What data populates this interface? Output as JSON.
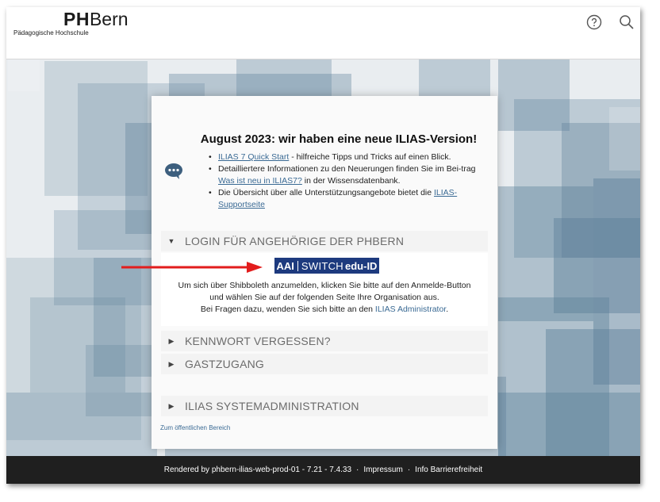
{
  "header": {
    "logo_bold": "PH",
    "logo_rest": "Bern",
    "logo_sub": "Pädagogische Hochschule",
    "help_icon": "help-circle-icon",
    "search_icon": "search-icon"
  },
  "news": {
    "title": "August 2023: wir haben eine neue ILIAS-Version!",
    "items": [
      {
        "link": "ILIAS 7 Quick Start",
        "text": " - hilfreiche Tipps und Tricks auf einen Blick."
      },
      {
        "text_before": "Detailliertere Informationen zu den Neuerungen finden Sie im Bei-trag ",
        "link": "Was ist neu in ILIAS7?",
        "text_after": " in der Wissensdatenbank."
      },
      {
        "text_before": "Die Übersicht über alle Unterstützungsangebote bietet die ",
        "link": "ILIAS-Supportseite"
      }
    ]
  },
  "accordion": {
    "login": {
      "label": "LOGIN FÜR ANGEHÖRIGE DER PHBERN",
      "button": {
        "aai": "AAI",
        "switch": "SWITCH",
        "eduid": "edu-ID"
      },
      "line1": "Um sich über Shibboleth anzumelden, klicken Sie bitte auf den Anmelde-Button",
      "line2": "und wählen Sie auf der folgenden Seite Ihre Organisation aus.",
      "line3_before": "Bei Fragen dazu, wenden Sie sich bitte an den ",
      "line3_link": "ILIAS Administrator",
      "line3_after": "."
    },
    "password": "KENNWORT VERGESSEN?",
    "guest": "GASTZUGANG",
    "sysadmin": "ILIAS SYSTEMADMINISTRATION"
  },
  "public_area": "Zum öffentlichen Bereich",
  "footer": {
    "rendered": "Rendered by phbern-ilias-web-prod-01 - 7.21 - 7.4.33",
    "sep": "·",
    "impressum": "Impressum",
    "barrierefreiheit": "Info Barrierefreiheit"
  },
  "colors": {
    "accent_link": "#3a6a94",
    "aai_button": "#1d3a7e",
    "arrow": "#e21d1d",
    "footer": "#1f1f1f"
  }
}
